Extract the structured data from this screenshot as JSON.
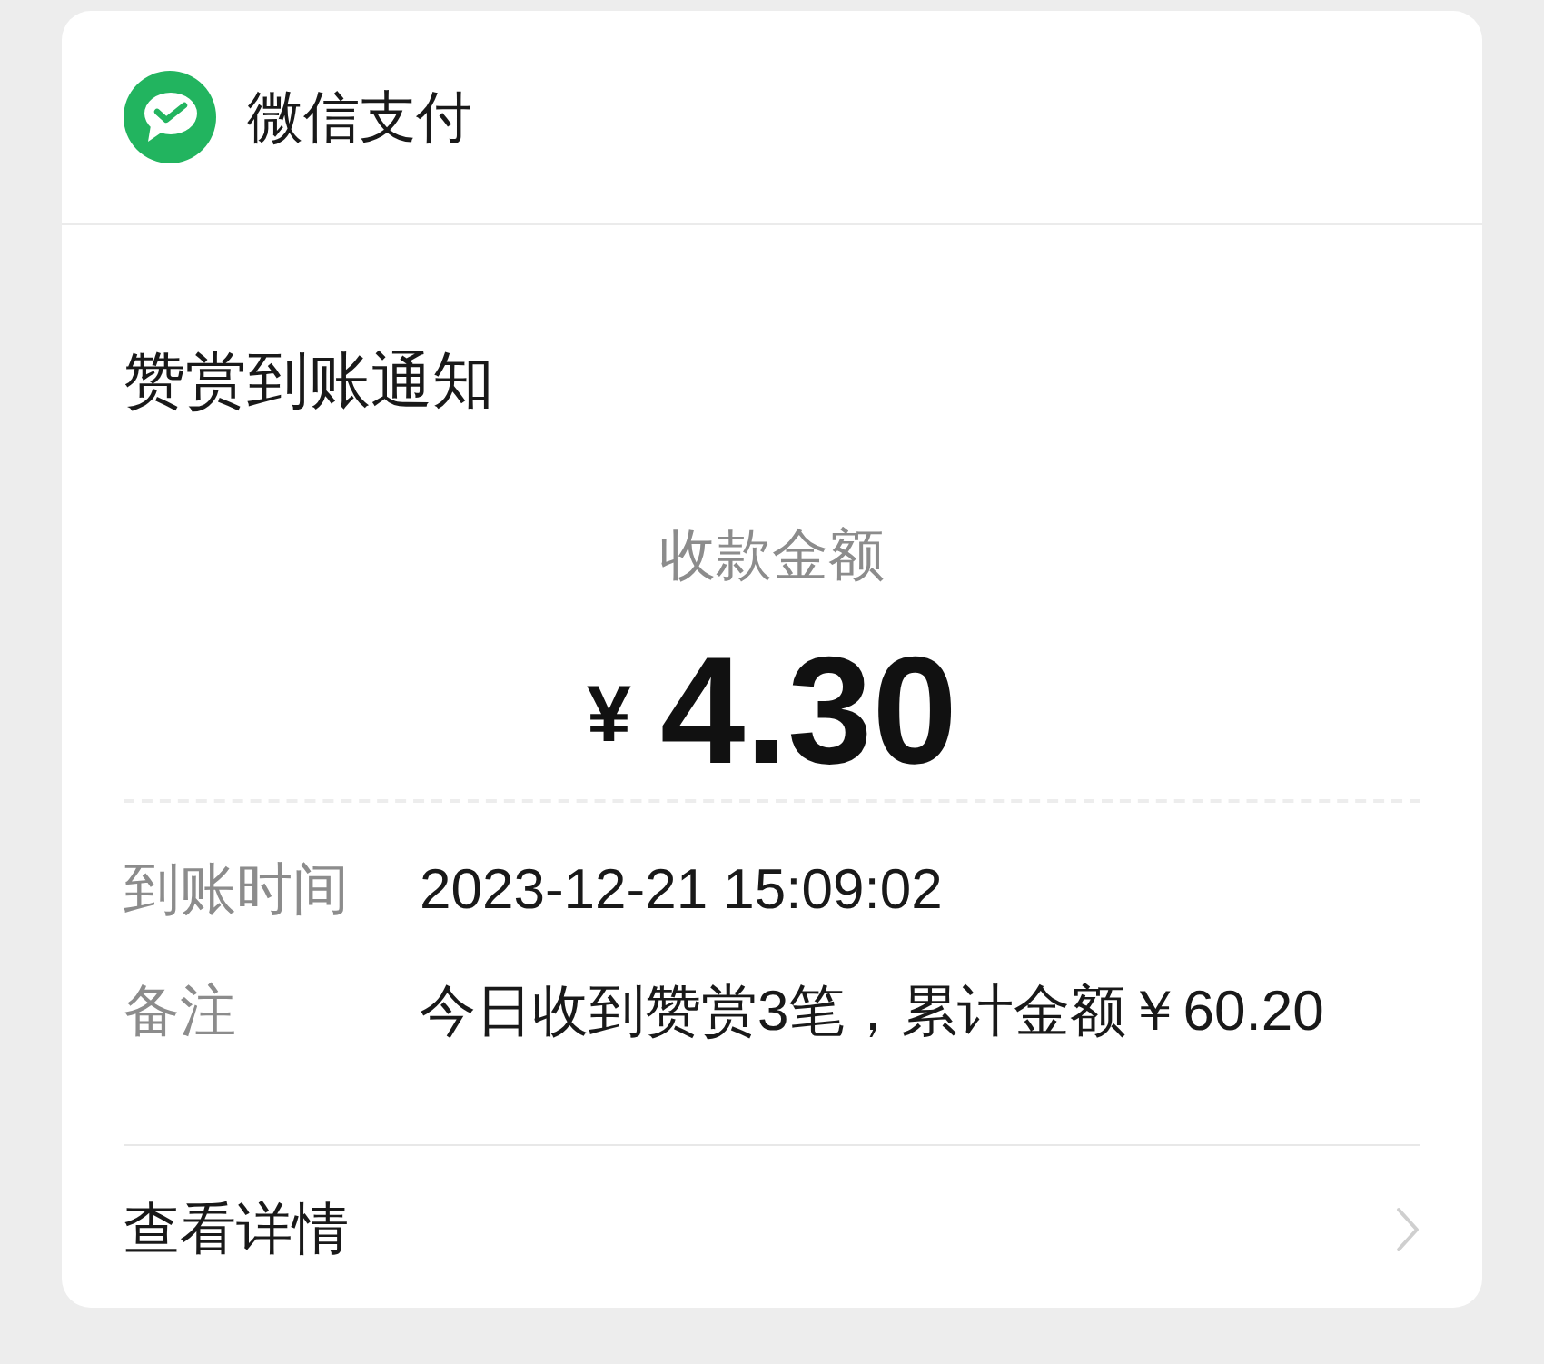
{
  "header": {
    "app_name": "微信支付"
  },
  "notice": {
    "title": "赞赏到账通知",
    "amount_label": "收款金额",
    "currency": "¥",
    "amount": "4.30"
  },
  "details": [
    {
      "label": "到账时间",
      "value": "2023-12-21 15:09:02"
    },
    {
      "label": "备注",
      "value": "今日收到赞赏3笔，累计金额￥60.20"
    }
  ],
  "footer": {
    "link": "查看详情"
  }
}
